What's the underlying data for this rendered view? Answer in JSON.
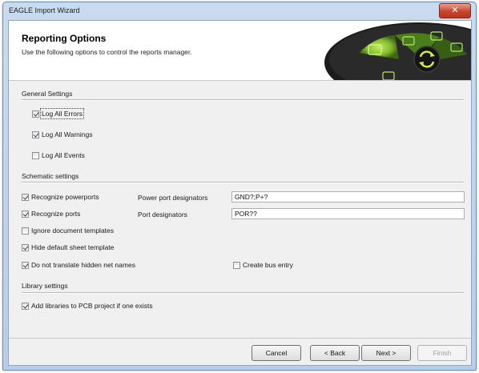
{
  "window": {
    "title": "EAGLE Import Wizard",
    "close_glyph": "✕"
  },
  "header": {
    "title": "Reporting Options",
    "subtitle": "Use the following options to control the reports manager."
  },
  "sections": {
    "general": "General Settings",
    "schematic": "Schematic settings",
    "library": "Library settings"
  },
  "general": {
    "log_errors": {
      "label": "Log All Errors",
      "checked": true
    },
    "log_warnings": {
      "label": "Log All Warnings",
      "checked": true
    },
    "log_events": {
      "label": "Log All Events",
      "checked": false
    }
  },
  "schematic": {
    "recognize_powerports": {
      "label": "Recognize powerports",
      "checked": true
    },
    "power_port_designators_label": "Power port designators",
    "power_port_designators_value": "GND?;P+?",
    "recognize_ports": {
      "label": "Recognize ports",
      "checked": true
    },
    "port_designators_label": "Port designators",
    "port_designators_value": "POR??",
    "ignore_templates": {
      "label": "Ignore document templates",
      "checked": false
    },
    "hide_sheet_template": {
      "label": "Hide default sheet template",
      "checked": true
    },
    "dont_translate_hidden": {
      "label": "Do not translate hidden net names",
      "checked": true
    },
    "create_bus_entry": {
      "label": "Create bus entry",
      "checked": false
    }
  },
  "library": {
    "add_libraries": {
      "label": "Add libraries to PCB project if one exists",
      "checked": true
    }
  },
  "buttons": {
    "cancel": "Cancel",
    "back": "< Back",
    "next": "Next >",
    "finish": "Finish"
  },
  "colors": {
    "accent_green": "#9ad63a",
    "banner_dark": "#1e1e1e",
    "close_red": "#c8452c"
  },
  "icons": {
    "banner": "reports-dial-graphic",
    "close": "close-icon",
    "checkbox": "checkmark"
  }
}
